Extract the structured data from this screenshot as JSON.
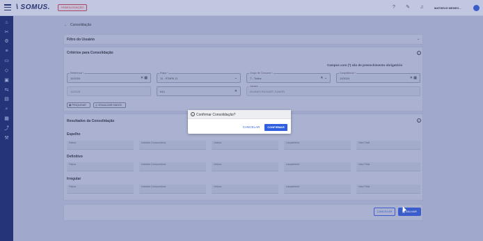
{
  "topbar": {
    "logo": "\\ SOMUS.",
    "env_badge": "HOMOLOGAÇÃO",
    "user_name": "MATHEUS MENEG..."
  },
  "breadcrumb": {
    "arrow": "←",
    "label": "Consolidação"
  },
  "filter_card": {
    "title": "Filtro do Usuário"
  },
  "criteria": {
    "title": "Critérios para Consolidação",
    "required_note": "Campos com (*) são de preenchimento obrigatório",
    "fields": [
      {
        "label": "Referência *",
        "value": "11/2024"
      },
      {
        "label": "Etapa *",
        "value": "11 - ETAPA 11"
      },
      {
        "label": "Grupo de Consumo *",
        "value": "T - Todos"
      },
      {
        "label": "Competência *",
        "value": "11/2024"
      }
    ],
    "fields_row2": [
      {
        "label": "",
        "value": "11/2024"
      },
      {
        "label": "",
        "value": "610"
      },
      {
        "label": "Usuário",
        "value": "ÁLVARO RICKART JUNIOR"
      }
    ],
    "buttons": [
      "PESQUISAR",
      "VISUALIZAR DADOS"
    ]
  },
  "results": {
    "title": "Resultados da Consolidação",
    "column_labels": [
      "Fatura",
      "Unidade Consumidora",
      "Leitura",
      "Lançamento",
      "Valor Total"
    ],
    "sections": [
      {
        "label": "Espelho",
        "values": [
          "-",
          "-",
          "-",
          "-",
          "-"
        ]
      },
      {
        "label": "Definitivo",
        "values": [
          "-",
          "-",
          "-",
          "-",
          "-"
        ]
      },
      {
        "label": "Irregular",
        "values": [
          "-",
          "-",
          "-",
          "-",
          "-"
        ]
      }
    ]
  },
  "footer": {
    "cancel": "CANCELAR",
    "save": "SALVAR"
  },
  "modal": {
    "title": "Confirmar Consolidação?",
    "cancel": "CANCELAR",
    "confirm": "CONFIRMAR"
  }
}
